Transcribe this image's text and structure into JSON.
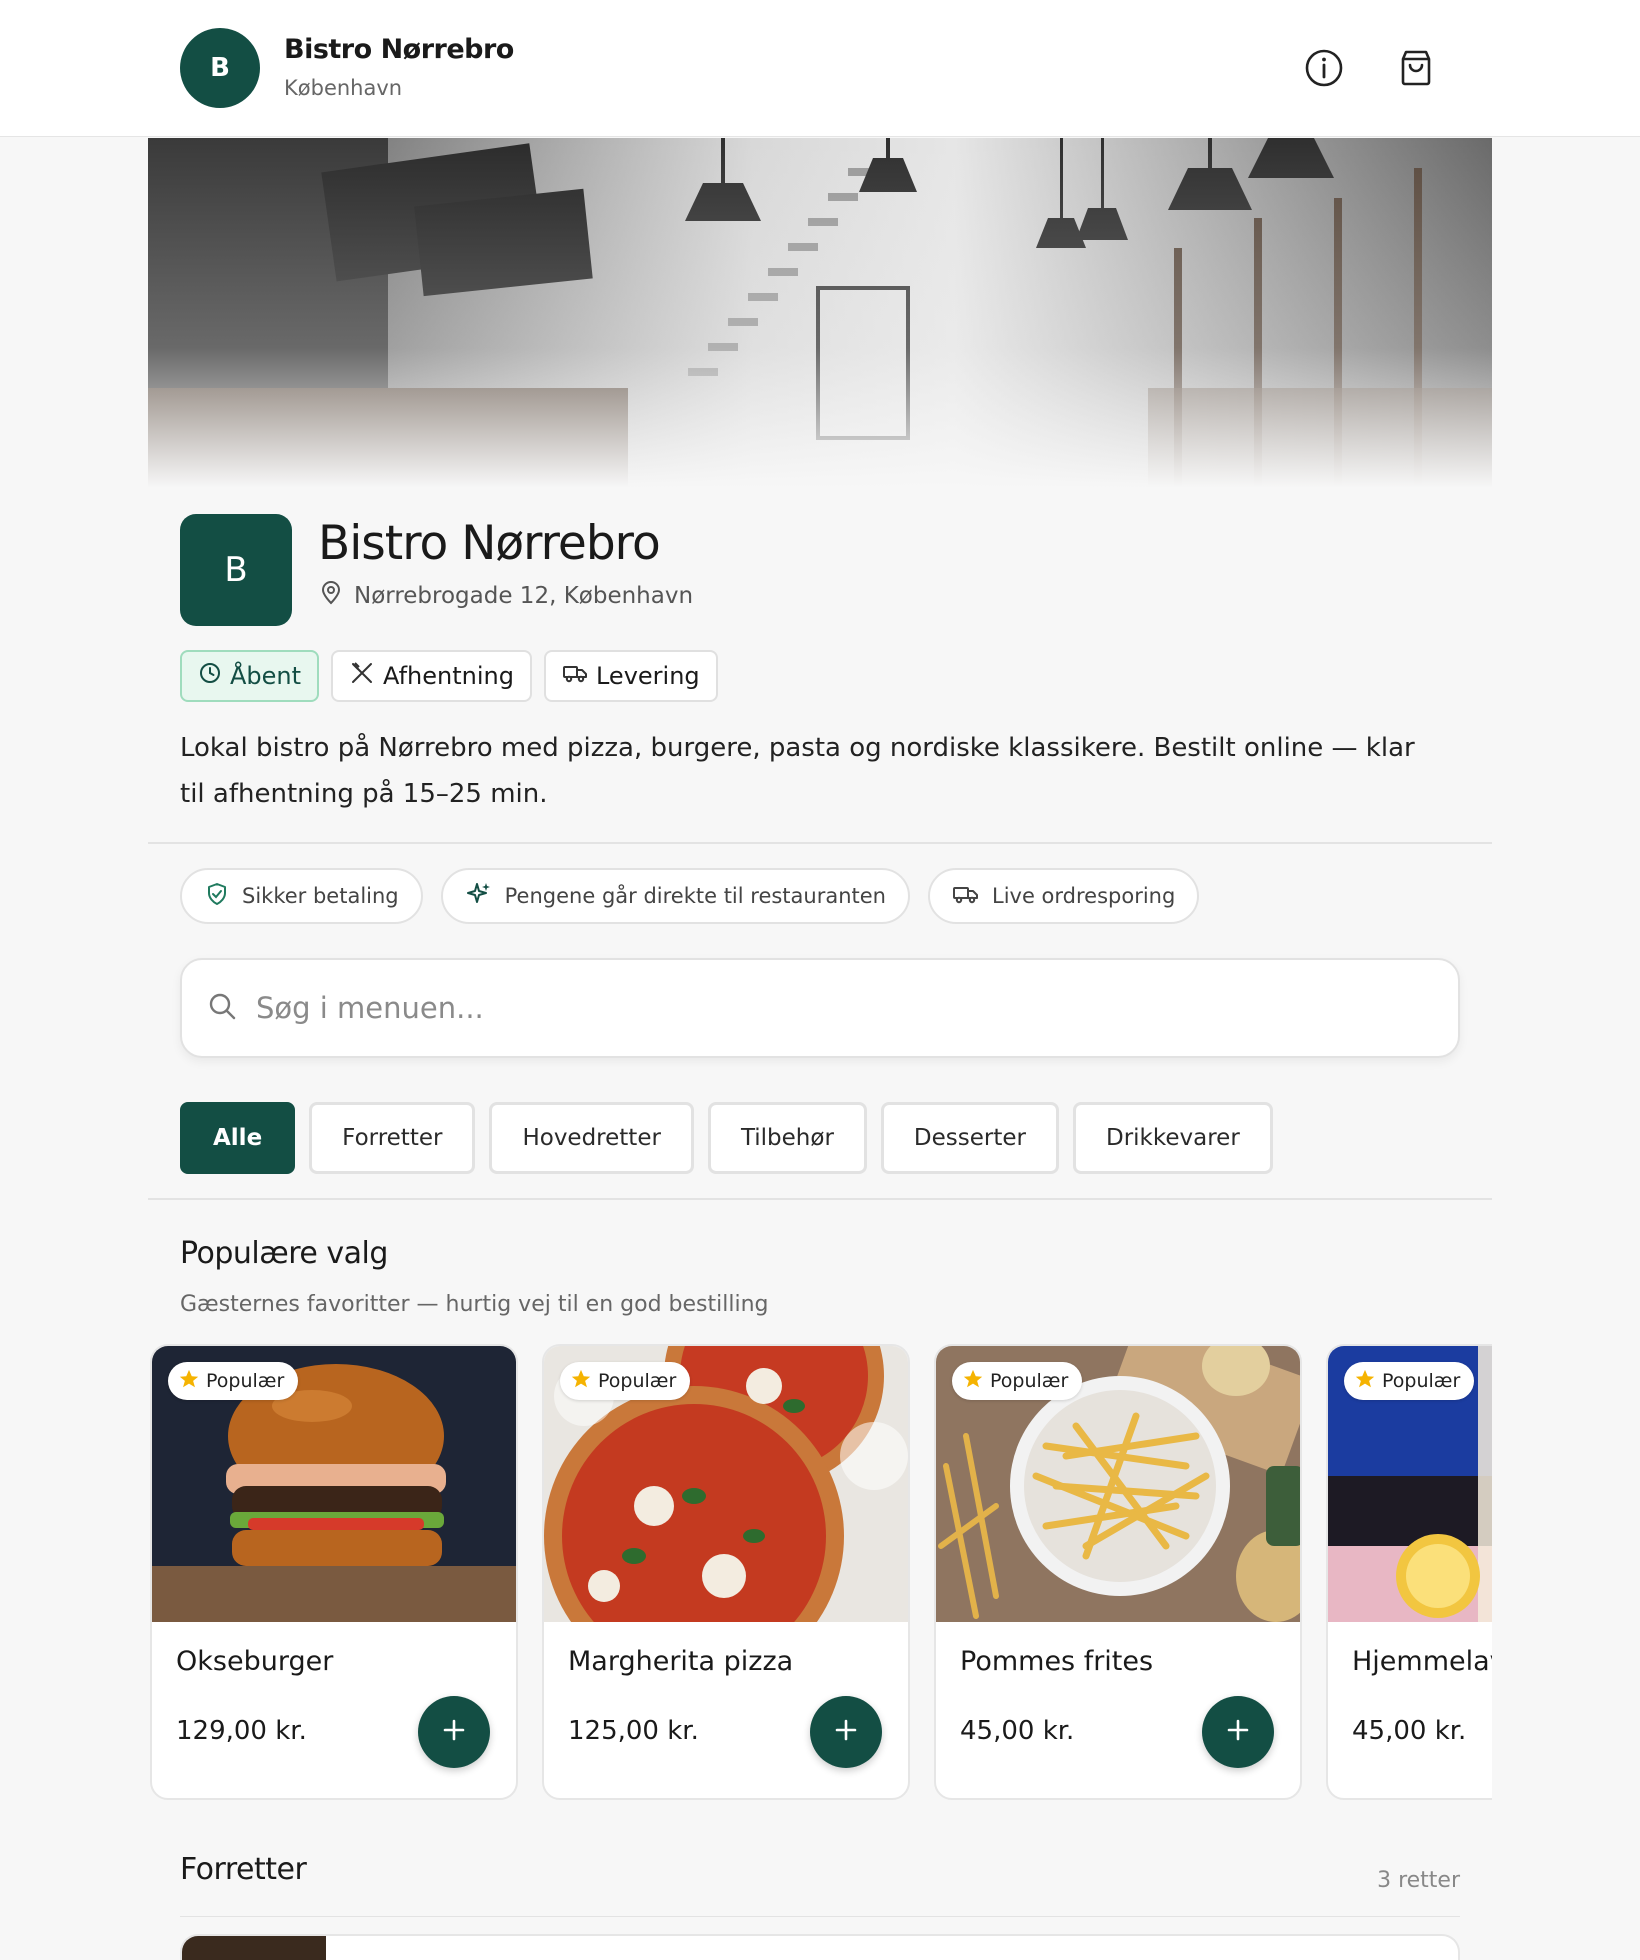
{
  "header": {
    "avatar_letter": "B",
    "title": "Bistro Nørrebro",
    "subtitle": "København",
    "icons": [
      "info-icon",
      "shopping-bag-icon"
    ]
  },
  "restaurant": {
    "logo_letter": "B",
    "name": "Bistro Nørrebro",
    "address": "Nørrebrogade 12, København",
    "tags": [
      {
        "label": "Åbent",
        "icon": "clock-icon"
      },
      {
        "label": "Afhentning",
        "icon": "utensils-icon"
      },
      {
        "label": "Levering",
        "icon": "truck-icon"
      }
    ],
    "description": "Lokal bistro på Nørrebro med pizza, burgere, pasta og nordiske klassikere. Bestilt online — klar til afhentning på 15–25 min."
  },
  "trust": [
    {
      "label": "Sikker betaling",
      "icon": "shield-check-icon"
    },
    {
      "label": "Pengene går direkte til restauranten",
      "icon": "sparkles-icon"
    },
    {
      "label": "Live ordresporing",
      "icon": "truck-icon"
    }
  ],
  "search": {
    "placeholder": "Søg i menuen..."
  },
  "categories": [
    "Alle",
    "Forretter",
    "Hovedretter",
    "Tilbehør",
    "Desserter",
    "Drikkevarer"
  ],
  "popular": {
    "title": "Populære valg",
    "subtitle": "Gæsternes favoritter — hurtig vej til en god bestilling",
    "badge_label": "Populær",
    "items": [
      {
        "name": "Okseburger",
        "price": "129,00 kr."
      },
      {
        "name": "Margherita pizza",
        "price": "125,00 kr."
      },
      {
        "name": "Pommes frites",
        "price": "45,00 kr."
      },
      {
        "name": "Hjemmelav",
        "price": "45,00 kr."
      }
    ]
  },
  "section": {
    "title": "Forretter",
    "count": "3 retter"
  },
  "colors": {
    "brand": "#134e44",
    "accent_star": "#f5b301",
    "open_bg": "#e8f7ef"
  }
}
